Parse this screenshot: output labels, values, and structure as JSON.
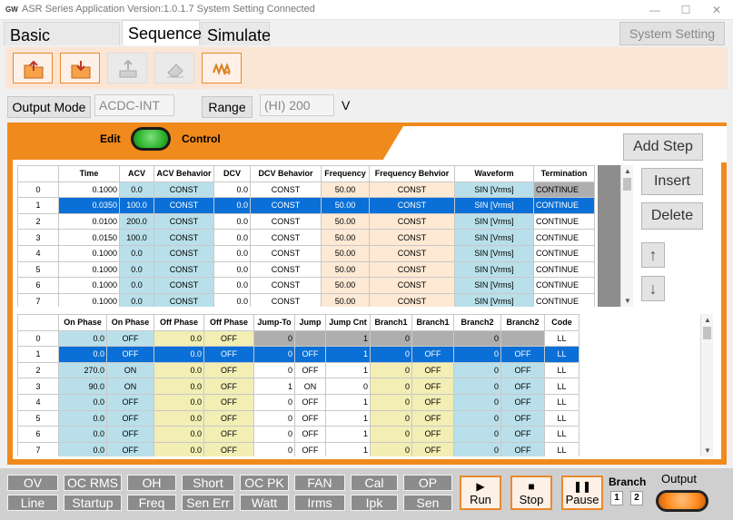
{
  "window": {
    "logo": "GW",
    "title": "ASR Series Application Version:1.0.1.7 System Setting Connected",
    "minimize": "—",
    "maximize": "☐",
    "close": "✕"
  },
  "tabs": [
    {
      "label": "Basic Controller"
    },
    {
      "label": "Sequence"
    },
    {
      "label": "Simulate"
    }
  ],
  "system_setting_label": "System Setting",
  "toolbar": [
    {
      "icon": "open-folder-icon"
    },
    {
      "icon": "save-folder-icon"
    },
    {
      "icon": "upload-icon"
    },
    {
      "icon": "eraser-icon"
    },
    {
      "icon": "waveform-icon"
    }
  ],
  "output_mode": {
    "label": "Output Mode",
    "value": "ACDC-INT"
  },
  "range": {
    "label": "Range",
    "value": "(HI) 200",
    "unit": "V"
  },
  "edit_control": {
    "edit": "Edit",
    "control": "Control"
  },
  "side_buttons": {
    "add_step": "Add Step",
    "insert": "Insert",
    "delete": "Delete",
    "up": "↑",
    "down": "↓"
  },
  "table1": {
    "headers": [
      "",
      "Time",
      "ACV",
      "ACV Behavior",
      "DCV",
      "DCV Behavior",
      "Frequency",
      "Frequency Behvior",
      "Waveform",
      "Termination"
    ],
    "rows": [
      [
        "0",
        "0.1000",
        "0.0",
        "CONST",
        "0.0",
        "CONST",
        "50.00",
        "CONST",
        "SIN [Vrms]",
        "CONTINUE"
      ],
      [
        "1",
        "0.0350",
        "100.0",
        "CONST",
        "0.0",
        "CONST",
        "50.00",
        "CONST",
        "SIN [Vrms]",
        "CONTINUE"
      ],
      [
        "2",
        "0.0100",
        "200.0",
        "CONST",
        "0.0",
        "CONST",
        "50.00",
        "CONST",
        "SIN [Vrms]",
        "CONTINUE"
      ],
      [
        "3",
        "0.0150",
        "100.0",
        "CONST",
        "0.0",
        "CONST",
        "50.00",
        "CONST",
        "SIN [Vrms]",
        "CONTINUE"
      ],
      [
        "4",
        "0.1000",
        "0.0",
        "CONST",
        "0.0",
        "CONST",
        "50.00",
        "CONST",
        "SIN [Vrms]",
        "CONTINUE"
      ],
      [
        "5",
        "0.1000",
        "0.0",
        "CONST",
        "0.0",
        "CONST",
        "50.00",
        "CONST",
        "SIN [Vrms]",
        "CONTINUE"
      ],
      [
        "6",
        "0.1000",
        "0.0",
        "CONST",
        "0.0",
        "CONST",
        "50.00",
        "CONST",
        "SIN [Vrms]",
        "CONTINUE"
      ],
      [
        "7",
        "0.1000",
        "0.0",
        "CONST",
        "0.0",
        "CONST",
        "50.00",
        "CONST",
        "SIN [Vrms]",
        "CONTINUE"
      ]
    ]
  },
  "table2": {
    "headers": [
      "",
      "On Phase",
      "On Phase",
      "Off Phase",
      "Off Phase",
      "Jump-To",
      "Jump",
      "Jump Cnt",
      "Branch1",
      "Branch1",
      "Branch2",
      "Branch2",
      "Code"
    ],
    "rows": [
      [
        "0",
        "0.0",
        "OFF",
        "0.0",
        "OFF",
        "0",
        "",
        "1",
        "0",
        "",
        "0",
        "",
        "LL"
      ],
      [
        "1",
        "0.0",
        "OFF",
        "0.0",
        "OFF",
        "0",
        "OFF",
        "1",
        "0",
        "OFF",
        "0",
        "OFF",
        "LL"
      ],
      [
        "2",
        "270.0",
        "ON",
        "0.0",
        "OFF",
        "0",
        "OFF",
        "1",
        "0",
        "OFF",
        "0",
        "OFF",
        "LL"
      ],
      [
        "3",
        "90.0",
        "ON",
        "0.0",
        "OFF",
        "1",
        "ON",
        "0",
        "0",
        "OFF",
        "0",
        "OFF",
        "LL"
      ],
      [
        "4",
        "0.0",
        "OFF",
        "0.0",
        "OFF",
        "0",
        "OFF",
        "1",
        "0",
        "OFF",
        "0",
        "OFF",
        "LL"
      ],
      [
        "5",
        "0.0",
        "OFF",
        "0.0",
        "OFF",
        "0",
        "OFF",
        "1",
        "0",
        "OFF",
        "0",
        "OFF",
        "LL"
      ],
      [
        "6",
        "0.0",
        "OFF",
        "0.0",
        "OFF",
        "0",
        "OFF",
        "1",
        "0",
        "OFF",
        "0",
        "OFF",
        "LL"
      ],
      [
        "7",
        "0.0",
        "OFF",
        "0.0",
        "OFF",
        "0",
        "OFF",
        "1",
        "0",
        "OFF",
        "0",
        "OFF",
        "LL"
      ]
    ]
  },
  "alarms_top": [
    "OV",
    "OC RMS",
    "OH",
    "Short",
    "OC PK",
    "FAN",
    "Cal",
    "OP"
  ],
  "alarms_bottom": [
    "Line",
    "Startup",
    "Freq",
    "Sen Err",
    "Watt",
    "Irms",
    "Ipk",
    "Sen"
  ],
  "controls": {
    "run": "Run",
    "stop": "Stop",
    "pause": "Pause",
    "branch": "Branch",
    "branch1": "1",
    "branch2": "2",
    "output": "Output"
  },
  "colors": {
    "accent": "#f08a1c",
    "selected": "#0a6fd6",
    "toggle": "#2fb52f",
    "output_led": "#ff8a1e"
  }
}
